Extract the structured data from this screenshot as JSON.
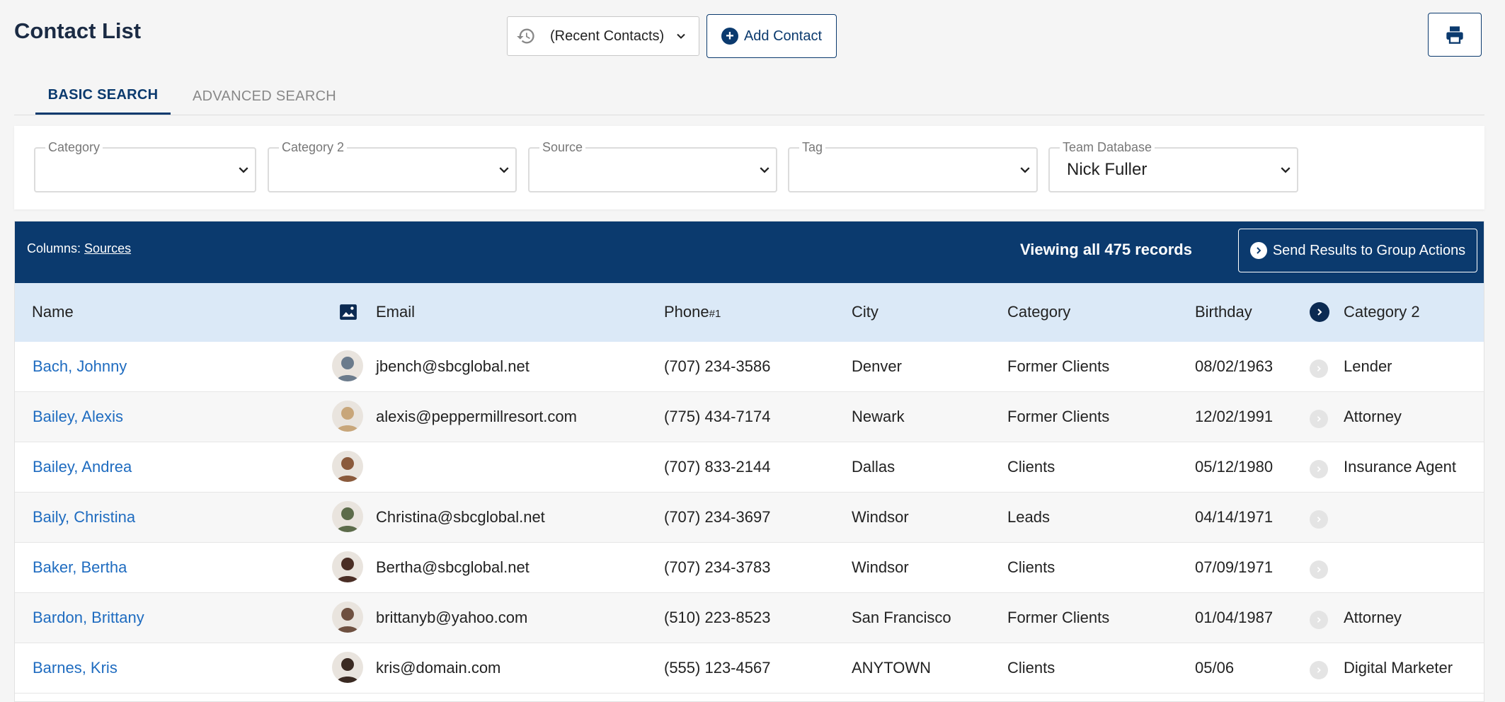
{
  "page": {
    "title": "Contact List"
  },
  "toolbar": {
    "recent_contacts": "(Recent Contacts)",
    "add_contact": "Add Contact"
  },
  "tabs": [
    {
      "label": "BASIC SEARCH",
      "active": true
    },
    {
      "label": "ADVANCED SEARCH",
      "active": false
    }
  ],
  "filters": [
    {
      "label": "Category",
      "value": ""
    },
    {
      "label": "Category 2",
      "value": ""
    },
    {
      "label": "Source",
      "value": ""
    },
    {
      "label": "Tag",
      "value": ""
    },
    {
      "label": "Team Database",
      "value": "Nick Fuller"
    }
  ],
  "results": {
    "columns_prefix": "Columns:",
    "columns_link": "Sources",
    "viewing_text": "Viewing all 475 records",
    "send_button": "Send Results to Group Actions"
  },
  "table": {
    "headers": {
      "name": "Name",
      "email": "Email",
      "phone": "Phone",
      "phone_sup": "#1",
      "city": "City",
      "category": "Category",
      "birthday": "Birthday",
      "category2": "Category 2"
    },
    "rows": [
      {
        "name": "Bach, Johnny",
        "email": "jbench@sbcglobal.net",
        "phone": "(707) 234-3586",
        "city": "Denver",
        "category": "Former Clients",
        "birthday": "08/02/1963",
        "category2": "Lender",
        "avatar_color": "#6b7b8c"
      },
      {
        "name": "Bailey, Alexis",
        "email": "alexis@peppermillresort.com",
        "phone": "(775) 434-7174",
        "city": "Newark",
        "category": "Former Clients",
        "birthday": "12/02/1991",
        "category2": "Attorney",
        "avatar_color": "#c8a67a"
      },
      {
        "name": "Bailey, Andrea",
        "email": "",
        "phone": "(707) 833-2144",
        "city": "Dallas",
        "category": "Clients",
        "birthday": "05/12/1980",
        "category2": "Insurance Agent",
        "avatar_color": "#8a5a3c"
      },
      {
        "name": "Baily, Christina",
        "email": "Christina@sbcglobal.net",
        "phone": "(707) 234-3697",
        "city": "Windsor",
        "category": "Leads",
        "birthday": "04/14/1971",
        "category2": "",
        "avatar_color": "#5c6b4a"
      },
      {
        "name": "Baker, Bertha",
        "email": "Bertha@sbcglobal.net",
        "phone": "(707) 234-3783",
        "city": "Windsor",
        "category": "Clients",
        "birthday": "07/09/1971",
        "category2": "",
        "avatar_color": "#4a2e25"
      },
      {
        "name": "Bardon, Brittany",
        "email": "brittanyb@yahoo.com",
        "phone": "(510) 223-8523",
        "city": "San Francisco",
        "category": "Former Clients",
        "birthday": "01/04/1987",
        "category2": "Attorney",
        "avatar_color": "#6e5040"
      },
      {
        "name": "Barnes, Kris",
        "email": "kris@domain.com",
        "phone": "(555) 123-4567",
        "city": "ANYTOWN",
        "category": "Clients",
        "birthday": "05/06",
        "category2": "Digital Marketer",
        "avatar_color": "#3a2a22"
      }
    ]
  },
  "colors": {
    "primary": "#0b3a6e",
    "link": "#1f6cc0",
    "header_bg": "#dbe9f7"
  }
}
